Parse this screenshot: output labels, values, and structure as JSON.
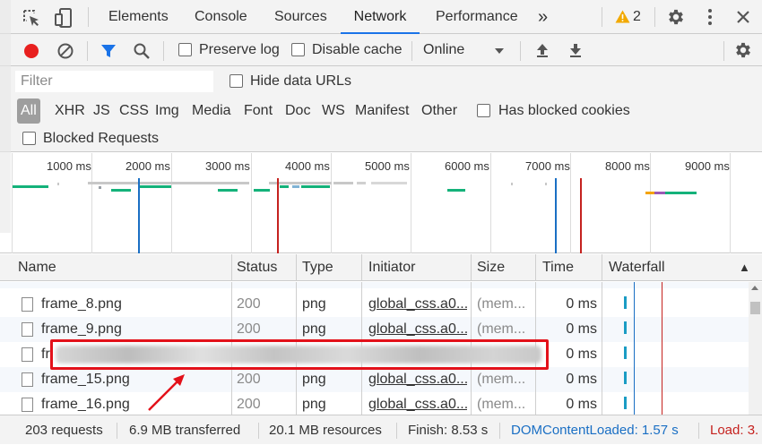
{
  "tabs": {
    "elements": "Elements",
    "console": "Console",
    "sources": "Sources",
    "network": "Network",
    "performance": "Performance",
    "more": "»",
    "warnings_count": "2"
  },
  "toolbar": {
    "preserve_log": "Preserve log",
    "disable_cache": "Disable cache",
    "throttle": "Online"
  },
  "filter": {
    "placeholder": "Filter",
    "hide_data_urls": "Hide data URLs",
    "types": [
      "All",
      "XHR",
      "JS",
      "CSS",
      "Img",
      "Media",
      "Font",
      "Doc",
      "WS",
      "Manifest",
      "Other"
    ],
    "has_blocked_cookies": "Has blocked cookies",
    "blocked_requests": "Blocked Requests"
  },
  "overview": {
    "ticks": [
      "1000 ms",
      "2000 ms",
      "3000 ms",
      "4000 ms",
      "5000 ms",
      "6000 ms",
      "7000 ms",
      "8000 ms",
      "9000 ms"
    ]
  },
  "table": {
    "headers": {
      "name": "Name",
      "status": "Status",
      "type": "Type",
      "initiator": "Initiator",
      "size": "Size",
      "time": "Time",
      "waterfall": "Waterfall",
      "sort_arrow": "▲"
    },
    "rows": [
      {
        "name": "frame_8.png",
        "status": "200",
        "type": "png",
        "initiator": "global_css.a0...",
        "size": "(mem...",
        "time": "0 ms"
      },
      {
        "name": "frame_9.png",
        "status": "200",
        "type": "png",
        "initiator": "global_css.a0...",
        "size": "(mem...",
        "time": "0 ms"
      },
      {
        "name": "fr",
        "status": "",
        "type": "",
        "initiator": "",
        "size": "",
        "time": "0 ms"
      },
      {
        "name": "frame_15.png",
        "status": "200",
        "type": "png",
        "initiator": "global_css.a0...",
        "size": "(mem...",
        "time": "0 ms"
      },
      {
        "name": "frame_16.png",
        "status": "200",
        "type": "png",
        "initiator": "global_css.a0...",
        "size": "(mem...",
        "time": "0 ms"
      }
    ]
  },
  "status_bar": {
    "requests": "203 requests",
    "transferred": "6.9 MB transferred",
    "resources": "20.1 MB resources",
    "finish": "Finish: 8.53 s",
    "dom_content_loaded": "DOMContentLoaded: 1.57 s",
    "load": "Load: 3."
  },
  "colors": {
    "accent": "#1a73e8",
    "record_red": "#e8201f",
    "dcl_blue": "#1a6fc4",
    "load_red": "#c5221f",
    "bar_green": "#14b27a",
    "annotation_red": "#e3111a"
  }
}
